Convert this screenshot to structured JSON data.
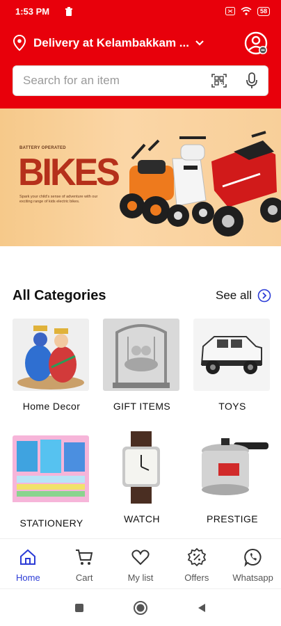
{
  "status_bar": {
    "time": "1:53 PM",
    "battery": "58"
  },
  "header": {
    "delivery_label": "Delivery at Kelambakkam ...",
    "search_placeholder": "Search for an item"
  },
  "banner": {
    "tagline": "BATTERY OPERATED",
    "title": "BIKES",
    "description": "Spark your child's sense of adventure with our exciting range of kids electric bikes."
  },
  "categories": {
    "title": "All Categories",
    "see_all": "See all",
    "items": [
      {
        "label": "Home Decor"
      },
      {
        "label": "GIFT ITEMS"
      },
      {
        "label": "TOYS"
      },
      {
        "label": "STATIONERY"
      },
      {
        "label": "WATCH"
      },
      {
        "label": "PRESTIGE"
      }
    ]
  },
  "bottom_nav": {
    "items": [
      {
        "label": "Home",
        "icon": "home-icon",
        "active": true
      },
      {
        "label": "Cart",
        "icon": "cart-icon"
      },
      {
        "label": "My list",
        "icon": "heart-icon"
      },
      {
        "label": "Offers",
        "icon": "offers-icon"
      },
      {
        "label": "Whatsapp",
        "icon": "whatsapp-icon"
      }
    ]
  },
  "colors": {
    "brand": "#e8000b",
    "active_nav": "#2b3bd6"
  }
}
